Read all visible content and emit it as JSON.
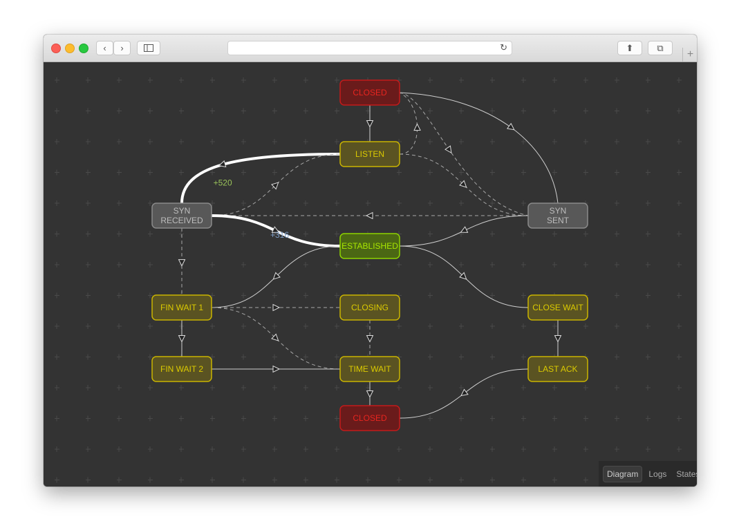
{
  "browser": {
    "url": ""
  },
  "view_tabs": [
    {
      "label": "Diagram",
      "active": true
    },
    {
      "label": "Logs",
      "active": false
    },
    {
      "label": "States",
      "active": false
    }
  ],
  "colors": {
    "background": "#333333",
    "edge": "#d0d0d0",
    "highlight_edge": "#ffffff"
  },
  "nodes": [
    {
      "id": "closed_top",
      "label": [
        "CLOSED"
      ],
      "style": "red"
    },
    {
      "id": "listen",
      "label": [
        "LISTEN"
      ],
      "style": "yellow"
    },
    {
      "id": "syn_received",
      "label": [
        "SYN",
        "RECEIVED"
      ],
      "style": "gray"
    },
    {
      "id": "syn_sent",
      "label": [
        "SYN",
        "SENT"
      ],
      "style": "gray"
    },
    {
      "id": "established",
      "label": [
        "ESTABLISHED"
      ],
      "style": "green"
    },
    {
      "id": "fin_wait_1",
      "label": [
        "FIN WAIT 1"
      ],
      "style": "yellow"
    },
    {
      "id": "closing",
      "label": [
        "CLOSING"
      ],
      "style": "yellow"
    },
    {
      "id": "close_wait",
      "label": [
        "CLOSE WAIT"
      ],
      "style": "yellow"
    },
    {
      "id": "fin_wait_2",
      "label": [
        "FIN WAIT 2"
      ],
      "style": "yellow"
    },
    {
      "id": "time_wait",
      "label": [
        "TIME WAIT"
      ],
      "style": "yellow"
    },
    {
      "id": "last_ack",
      "label": [
        "LAST ACK"
      ],
      "style": "yellow"
    },
    {
      "id": "closed_bottom",
      "label": [
        "CLOSED"
      ],
      "style": "red"
    }
  ],
  "edges": [
    {
      "from": "closed_top",
      "to": "listen",
      "kind": "solid"
    },
    {
      "from": "listen",
      "to": "closed_top",
      "kind": "dashed"
    },
    {
      "from": "closed_top",
      "to": "syn_sent",
      "kind": "solid"
    },
    {
      "from": "closed_top",
      "to": "syn_sent",
      "kind": "dashed"
    },
    {
      "from": "listen",
      "to": "syn_sent",
      "kind": "dashed"
    },
    {
      "from": "listen",
      "to": "syn_received",
      "kind": "highlight",
      "label": "+520",
      "label_color": "#9bc45a"
    },
    {
      "from": "syn_received",
      "to": "listen",
      "kind": "dashed"
    },
    {
      "from": "syn_sent",
      "to": "syn_received",
      "kind": "dashed"
    },
    {
      "from": "syn_received",
      "to": "established",
      "kind": "highlight",
      "label": "+316",
      "label_color": "#7f9fc8"
    },
    {
      "from": "syn_sent",
      "to": "established",
      "kind": "solid"
    },
    {
      "from": "established",
      "to": "fin_wait_1",
      "kind": "solid"
    },
    {
      "from": "established",
      "to": "close_wait",
      "kind": "solid"
    },
    {
      "from": "syn_received",
      "to": "fin_wait_1",
      "kind": "dashed"
    },
    {
      "from": "fin_wait_1",
      "to": "closing",
      "kind": "dashed"
    },
    {
      "from": "fin_wait_1",
      "to": "time_wait",
      "kind": "dashed"
    },
    {
      "from": "fin_wait_1",
      "to": "fin_wait_2",
      "kind": "solid"
    },
    {
      "from": "closing",
      "to": "time_wait",
      "kind": "dashed"
    },
    {
      "from": "fin_wait_2",
      "to": "time_wait",
      "kind": "solid"
    },
    {
      "from": "close_wait",
      "to": "last_ack",
      "kind": "solid"
    },
    {
      "from": "time_wait",
      "to": "closed_bottom",
      "kind": "solid"
    },
    {
      "from": "last_ack",
      "to": "closed_bottom",
      "kind": "solid"
    }
  ]
}
